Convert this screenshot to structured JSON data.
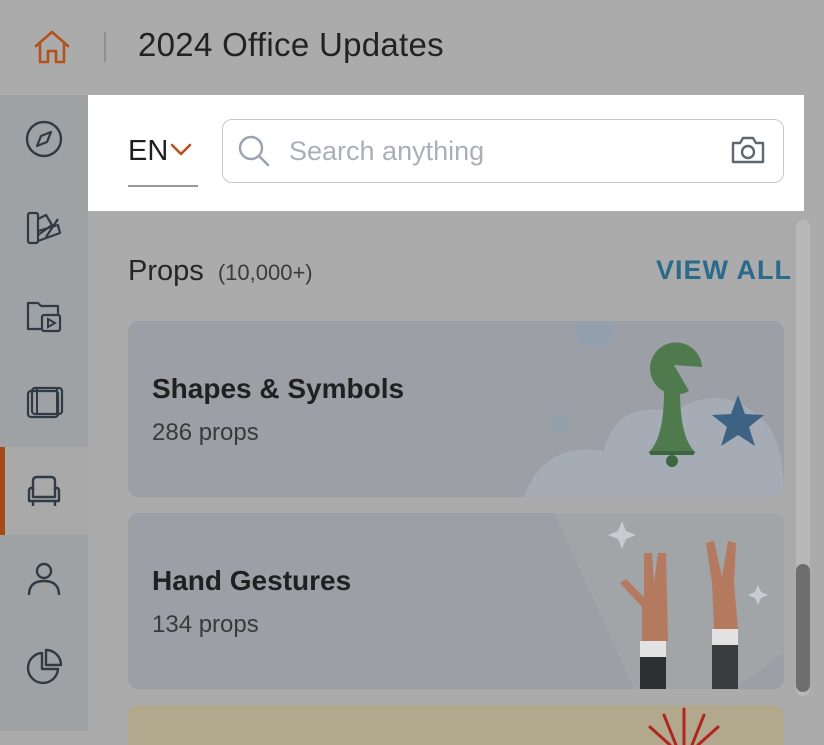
{
  "header": {
    "title": "2024 Office Updates"
  },
  "rail": {
    "items": [
      {
        "icon": "compass-icon",
        "active": false
      },
      {
        "icon": "design-palette-icon",
        "active": false
      },
      {
        "icon": "media-folder-icon",
        "active": false
      },
      {
        "icon": "film-frames-icon",
        "active": false
      },
      {
        "icon": "armchair-icon",
        "active": true
      },
      {
        "icon": "person-icon",
        "active": false
      },
      {
        "icon": "pie-chart-icon",
        "active": false
      }
    ]
  },
  "search": {
    "language": "EN",
    "placeholder": "Search anything",
    "value": ""
  },
  "section": {
    "title": "Props",
    "count": "(10,000+)",
    "view_all": "VIEW ALL"
  },
  "cards": [
    {
      "title": "Shapes & Symbols",
      "subtitle": "286 props"
    },
    {
      "title": "Hand Gestures",
      "subtitle": "134 props"
    }
  ],
  "colors": {
    "accent": "#a44a16",
    "link": "#2a6a8a"
  }
}
